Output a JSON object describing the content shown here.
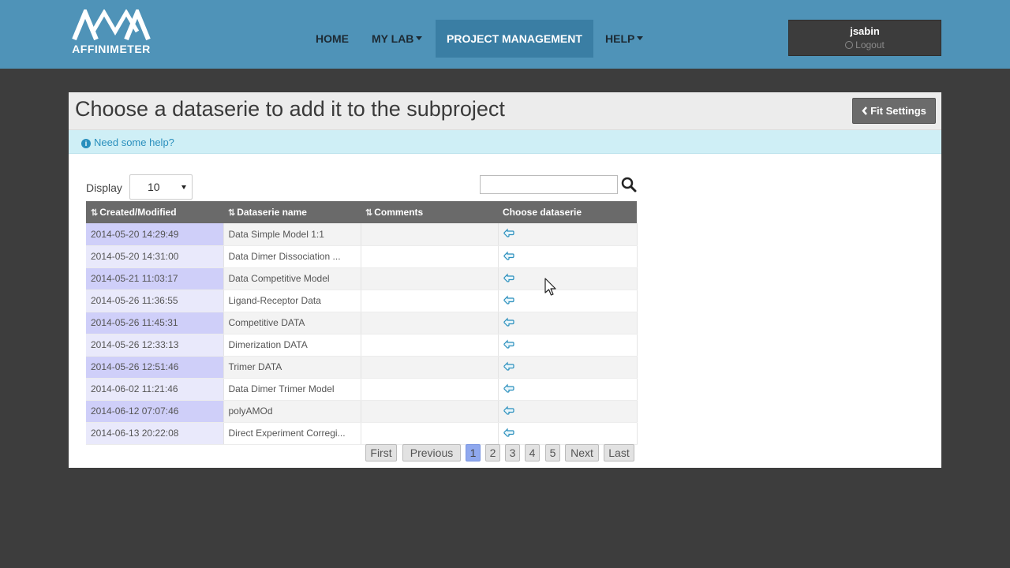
{
  "brand": {
    "name": "AFFINIMETER"
  },
  "nav": {
    "home": "HOME",
    "mylab": "MY LAB",
    "project": "PROJECT MANAGEMENT",
    "help": "HELP"
  },
  "user": {
    "name": "jsabin",
    "logout": "Logout"
  },
  "page": {
    "title": "Choose a dataserie to add it to the subproject",
    "fit_settings": "Fit Settings",
    "help_link": "Need some help?"
  },
  "controls": {
    "display_label": "Display",
    "display_value": "10",
    "search_placeholder": ""
  },
  "table": {
    "headers": [
      "Created/Modified",
      "Dataserie name",
      "Comments",
      "Choose dataserie"
    ],
    "rows": [
      {
        "created": "2014-05-20 14:29:49",
        "name": "Data Simple Model 1:1",
        "comments": ""
      },
      {
        "created": "2014-05-20 14:31:00",
        "name": "Data Dimer Dissociation ...",
        "comments": ""
      },
      {
        "created": "2014-05-21 11:03:17",
        "name": "Data Competitive Model",
        "comments": ""
      },
      {
        "created": "2014-05-26 11:36:55",
        "name": "Ligand-Receptor Data",
        "comments": ""
      },
      {
        "created": "2014-05-26 11:45:31",
        "name": "Competitive DATA",
        "comments": ""
      },
      {
        "created": "2014-05-26 12:33:13",
        "name": "Dimerization DATA",
        "comments": ""
      },
      {
        "created": "2014-05-26 12:51:46",
        "name": "Trimer DATA",
        "comments": ""
      },
      {
        "created": "2014-06-02 11:21:46",
        "name": "Data Dimer Trimer Model",
        "comments": ""
      },
      {
        "created": "2014-06-12 07:07:46",
        "name": "polyAMOd",
        "comments": ""
      },
      {
        "created": "2014-06-13 20:22:08",
        "name": "Direct Experiment Corregi...",
        "comments": ""
      }
    ]
  },
  "pagination": {
    "first": "First",
    "previous": "Previous",
    "pages": [
      "1",
      "2",
      "3",
      "4",
      "5"
    ],
    "current": "1",
    "next": "Next",
    "last": "Last"
  },
  "colors": {
    "navbar": "#4f93b8",
    "nav_active": "#3a7ea4",
    "background": "#3d3d3d",
    "help_bar": "#cfeff6",
    "link": "#2a8fbd",
    "table_header": "#6a6a6a",
    "page_active": "#8fa8ee"
  },
  "icons": {
    "logo": "affinimeter-logo",
    "caret": "caret-down-icon",
    "logout": "power-icon",
    "back": "chevron-left-icon",
    "info": "info-circle-icon",
    "search": "magnifier-icon",
    "sort": "sort-icon",
    "choose": "hand-pointer-icon"
  }
}
